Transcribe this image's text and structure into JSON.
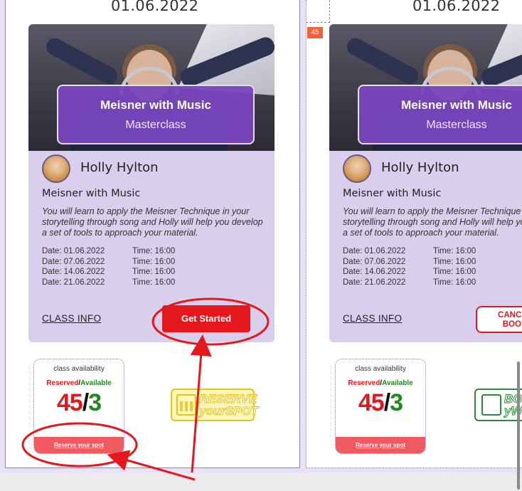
{
  "cards": [
    {
      "date_heading": "01.06.2022",
      "banner_title": "Meisner with Music",
      "banner_subtitle": "Masterclass",
      "teacher": "Holly Hylton",
      "class_title": "Meisner with Music",
      "description": "You will learn to apply the Meisner Technique in your storytelling through song and Holly will help you develop a set of tools to approach your material.",
      "schedule": [
        {
          "date": "Date: 01.06.2022",
          "time": "Time: 16:00"
        },
        {
          "date": "Date: 07.06.2022",
          "time": "Time: 16:00"
        },
        {
          "date": "Date: 14.06.2022",
          "time": "Time: 16:00"
        },
        {
          "date": "Date: 21.06.2022",
          "time": "Time: 16:00"
        }
      ],
      "class_info": "CLASS INFO",
      "action_label": "Get Started",
      "availability": {
        "label": "class availability",
        "reserved_word": "Reserved",
        "slash": "/",
        "available_word": "Available",
        "reserved": "45",
        "available": "3",
        "footer": "Reserve your spot"
      },
      "logo_text": [
        "RESERVE",
        "yourSPOT"
      ]
    },
    {
      "date_heading": "01.06.2022",
      "banner_title": "Meisner with Music",
      "banner_subtitle": "Masterclass",
      "teacher": "Holly Hylton",
      "class_title": "Meisner with Music",
      "description": "You will learn to apply the Meisner Technique in your storytelling through song and Holly will help you develop a set of tools to approach your material.",
      "schedule": [
        {
          "date": "Date: 01.06.2022",
          "time": "Time: 16:00"
        },
        {
          "date": "Date: 07.06.2022",
          "time": "Time: 16:00"
        },
        {
          "date": "Date: 14.06.2022",
          "time": "Time: 16:00"
        },
        {
          "date": "Date: 21.06.2022",
          "time": "Time: 16:00"
        }
      ],
      "class_info": "CLASS INFO",
      "action_label_line1": "CANCEL",
      "action_label_line2": "BOOK",
      "availability": {
        "label": "class availability",
        "reserved_word": "Reserved",
        "slash": "/",
        "available_word": "Available",
        "reserved": "45",
        "available": "3",
        "footer": "Reserve your spot"
      },
      "logo_text": [
        "BO",
        "yW"
      ]
    }
  ],
  "guide_badge": "45",
  "annotation_color": "#e4181c"
}
